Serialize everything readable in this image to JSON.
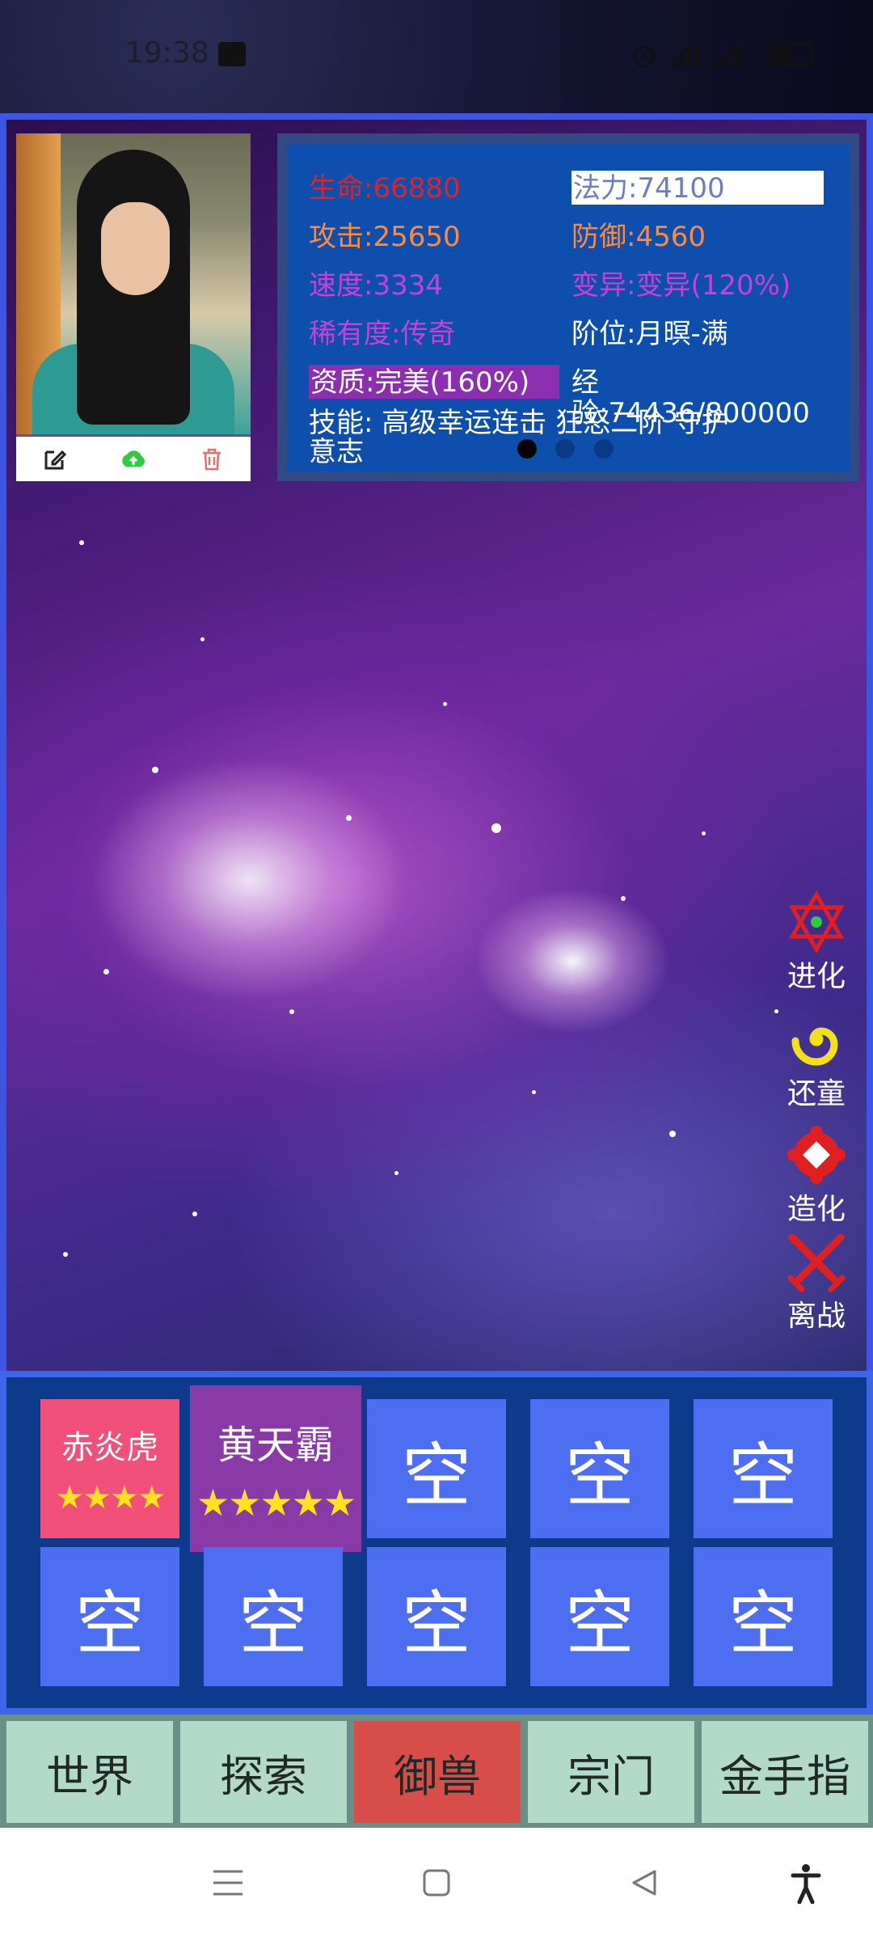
{
  "status_bar": {
    "time": "19:38"
  },
  "profile": {
    "actions": [
      {
        "name": "edit-icon"
      },
      {
        "name": "upload-cloud-icon"
      },
      {
        "name": "delete-icon"
      }
    ]
  },
  "stats": {
    "hp": "生命:66880",
    "mana": "法力:74100",
    "attack": "攻击:25650",
    "defense": "防御:4560",
    "speed": "速度:3334",
    "mutation": "变异:变异(120%)",
    "rarity": "稀有度:传奇",
    "rank": "阶位:月暝-满",
    "quality": "资质:完美(160%)",
    "exp_line1": "经",
    "exp_line2": "验:74436/800000",
    "skills_line1": "技能: 高级幸运连击  狂怒二阶  守护",
    "skills_line2": "意志",
    "pager": {
      "count": 3,
      "active_index": 0
    }
  },
  "side_actions": [
    {
      "label": "进化",
      "icon": "hexagram-icon"
    },
    {
      "label": "还童",
      "icon": "spiral-icon"
    },
    {
      "label": "造化",
      "icon": "diamond-ring-icon"
    },
    {
      "label": "离战",
      "icon": "crossed-swords-icon"
    }
  ],
  "team_slots": [
    {
      "label": "赤炎虎",
      "stars": "★★★★",
      "star_count": 4
    },
    {
      "label": "黄天霸",
      "stars": "★★★★★",
      "star_count": 5
    },
    {
      "label": "空"
    },
    {
      "label": "空"
    },
    {
      "label": "空"
    },
    {
      "label": "空"
    },
    {
      "label": "空"
    },
    {
      "label": "空"
    },
    {
      "label": "空"
    },
    {
      "label": "空"
    }
  ],
  "bottom_nav": {
    "tabs": [
      "世界",
      "探索",
      "御兽",
      "宗门",
      "金手指"
    ],
    "active_index": 2
  },
  "colors": {
    "accent_blue": "#3d65e8",
    "slot_blue": "#4d6ef0",
    "active_tab": "#d64d49",
    "tab_bg": "#b3d9c8",
    "pet_pink": "#f0507a",
    "pet_purple": "#8a3aa6"
  }
}
